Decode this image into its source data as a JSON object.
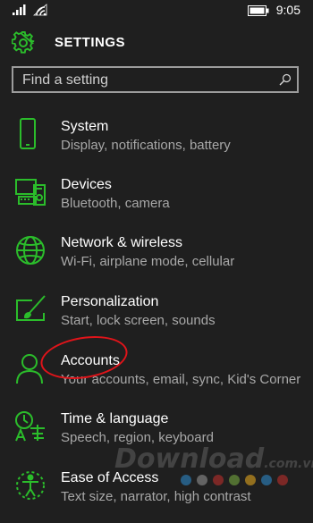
{
  "status_bar": {
    "time": "9:05"
  },
  "header": {
    "title": "SETTINGS",
    "icon": "gear-icon"
  },
  "search": {
    "placeholder": "Find a setting",
    "icon": "search-icon"
  },
  "items": [
    {
      "label": "System",
      "sub": "Display, notifications, battery",
      "icon": "phone-icon"
    },
    {
      "label": "Devices",
      "sub": "Bluetooth, camera",
      "icon": "devices-icon"
    },
    {
      "label": "Network & wireless",
      "sub": "Wi-Fi, airplane mode, cellular",
      "icon": "globe-icon"
    },
    {
      "label": "Personalization",
      "sub": "Start, lock screen, sounds",
      "icon": "personalization-icon"
    },
    {
      "label": "Accounts",
      "sub": "Your accounts, email, sync, Kid's Corner",
      "icon": "person-icon"
    },
    {
      "label": "Time & language",
      "sub": "Speech, region, keyboard",
      "icon": "time-language-icon"
    },
    {
      "label": "Ease of Access",
      "sub": "Text size, narrator, high contrast",
      "icon": "ease-of-access-icon"
    }
  ],
  "watermark": {
    "text": "Download",
    "suffix": ".com.vn"
  },
  "colors": {
    "accent": "#2bbd2b",
    "background": "#1f1f1f",
    "annotation": "#e0141a",
    "watermark_dots": [
      "#2e8fd6",
      "#9a9a9a",
      "#c9302c",
      "#7cb342",
      "#f2b01e",
      "#2e8fd6",
      "#c9302c"
    ]
  }
}
